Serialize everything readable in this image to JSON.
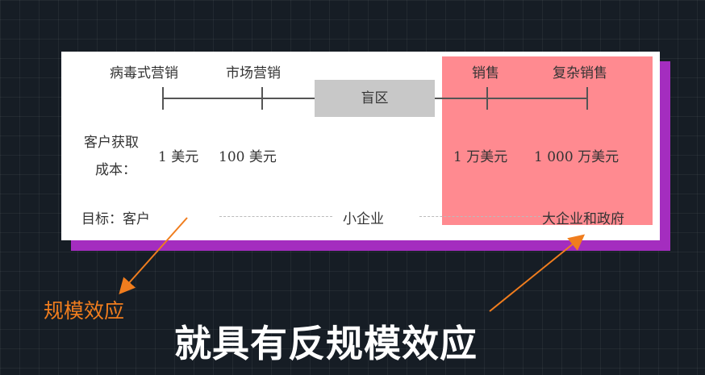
{
  "diagram": {
    "top_labels": {
      "viral_marketing": "病毒式营销",
      "market_marketing": "市场营销",
      "sales": "销售",
      "complex_sales": "复杂销售"
    },
    "blind_zone": "盲区",
    "cac": {
      "label_line1": "客户获取",
      "label_line2": "成本：",
      "values": [
        "1 美元",
        "100 美元",
        "1 万美元",
        "1 000 万美元"
      ]
    },
    "targets": {
      "label": "目标：客户",
      "small_business": "小企业",
      "enterprise_gov": "大企业和政府"
    }
  },
  "annotation_left": "规模效应",
  "caption": "就具有反规模效应",
  "colors": {
    "background": "#161d25",
    "card": "#ffffff",
    "highlight": "#ff8a90",
    "shadow": "#a42dbf",
    "arrow": "#f07d1e"
  }
}
